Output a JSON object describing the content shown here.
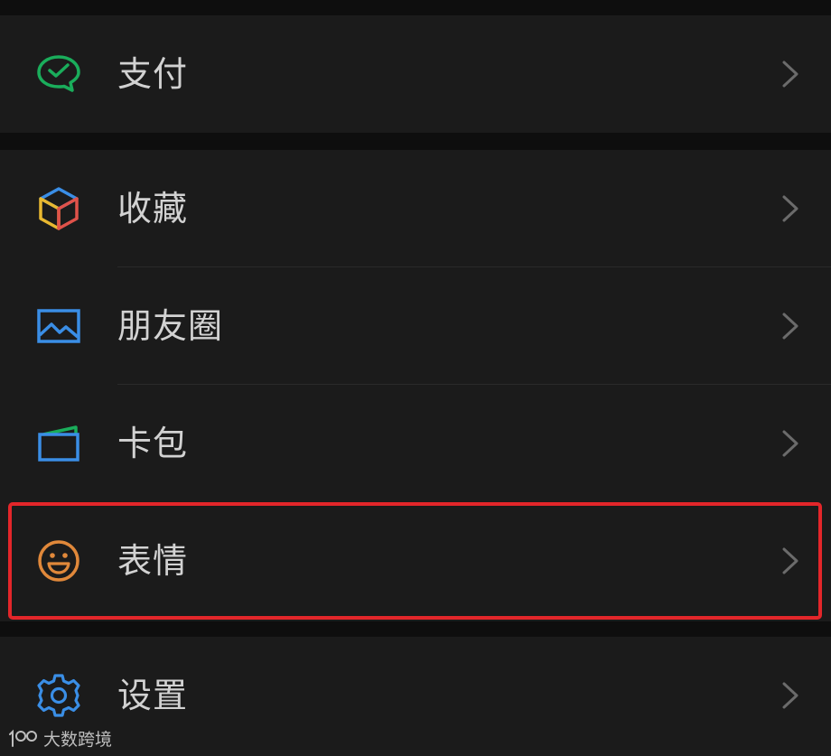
{
  "menu": {
    "pay": {
      "label": "支付",
      "icon": "wechat-pay-icon",
      "color": "#1aad5b"
    },
    "favorites": {
      "label": "收藏",
      "icon": "cube-icon",
      "colors": [
        "#e8b830",
        "#3a8ee6",
        "#e0524a"
      ]
    },
    "moments": {
      "label": "朋友圈",
      "icon": "image-icon",
      "color": "#3a8ee6"
    },
    "cards": {
      "label": "卡包",
      "icon": "wallet-icon",
      "colors": [
        "#3a8ee6",
        "#1aad5b"
      ]
    },
    "stickers": {
      "label": "表情",
      "icon": "smiley-icon",
      "color": "#e0883a",
      "highlighted": true
    },
    "settings": {
      "label": "设置",
      "icon": "gear-icon",
      "color": "#3a8ee6"
    }
  },
  "highlight_color": "#e3262a",
  "watermark": {
    "text": "大数跨境",
    "logo": "100-logo"
  }
}
